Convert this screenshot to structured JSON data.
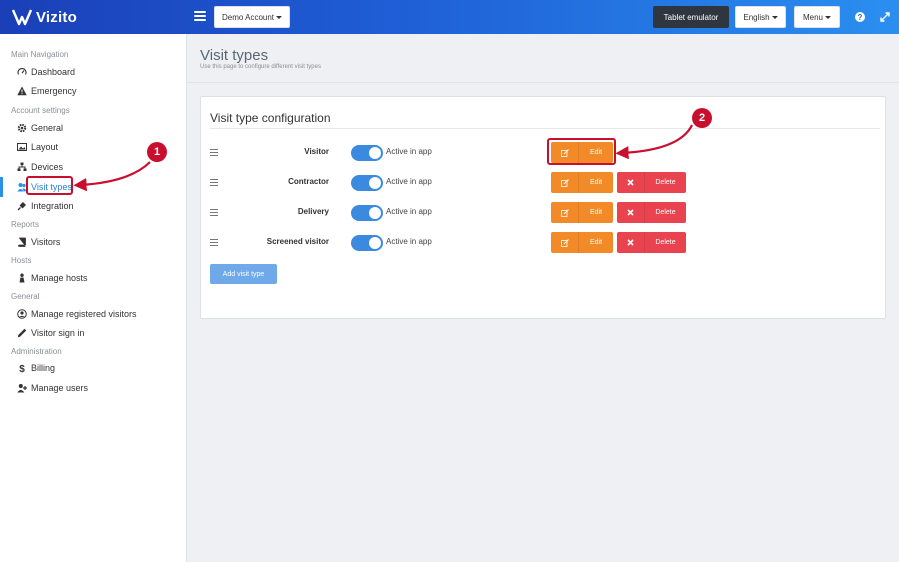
{
  "app": {
    "name": "Vizito"
  },
  "topbar": {
    "account_label": "Demo Account",
    "tablet_label": "Tablet emulator",
    "language_label": "English",
    "menu_label": "Menu",
    "help_icon": "question-icon",
    "expand_icon": "expand-icon"
  },
  "sidebar": {
    "sections": [
      {
        "label": "Main Navigation",
        "items": [
          {
            "label": "Dashboard",
            "icon": "gauge-icon"
          },
          {
            "label": "Emergency",
            "icon": "warning-icon"
          }
        ]
      },
      {
        "label": "Account settings",
        "items": [
          {
            "label": "General",
            "icon": "gear-icon"
          },
          {
            "label": "Layout",
            "icon": "image-icon"
          },
          {
            "label": "Devices",
            "icon": "sitemap-icon"
          },
          {
            "label": "Visit types",
            "icon": "users-icon",
            "active": true
          },
          {
            "label": "Integration",
            "icon": "plug-icon"
          }
        ]
      },
      {
        "label": "Reports",
        "items": [
          {
            "label": "Visitors",
            "icon": "book-icon"
          }
        ]
      },
      {
        "label": "Hosts",
        "items": [
          {
            "label": "Manage hosts",
            "icon": "person-icon"
          }
        ]
      },
      {
        "label": "General",
        "items": [
          {
            "label": "Manage registered visitors",
            "icon": "user-circle-icon"
          },
          {
            "label": "Visitor sign in",
            "icon": "pencil-icon"
          }
        ]
      },
      {
        "label": "Administration",
        "items": [
          {
            "label": "Billing",
            "icon": "dollar-icon"
          },
          {
            "label": "Manage users",
            "icon": "user-plus-icon"
          }
        ]
      }
    ]
  },
  "page": {
    "title": "Visit types",
    "subtitle": "Use this page to configure different visit types"
  },
  "card": {
    "title": "Visit type configuration",
    "toggle_label": "Active in app",
    "edit_label": "Edit",
    "delete_label": "Delete",
    "add_label": "Add visit type",
    "rows": [
      {
        "name": "Visitor",
        "active": true,
        "deletable": false
      },
      {
        "name": "Contractor",
        "active": true,
        "deletable": true
      },
      {
        "name": "Delivery",
        "active": true,
        "deletable": true
      },
      {
        "name": "Screened visitor",
        "active": true,
        "deletable": true
      }
    ]
  },
  "annotations": {
    "badge1": "1",
    "badge2": "2",
    "color": "#c8102e"
  },
  "colors": {
    "edit": "#f28a28",
    "delete": "#e8434f",
    "toggle": "#3b8ae0",
    "add": "#6fa9ea",
    "active_nav": "#2b7fd4"
  }
}
